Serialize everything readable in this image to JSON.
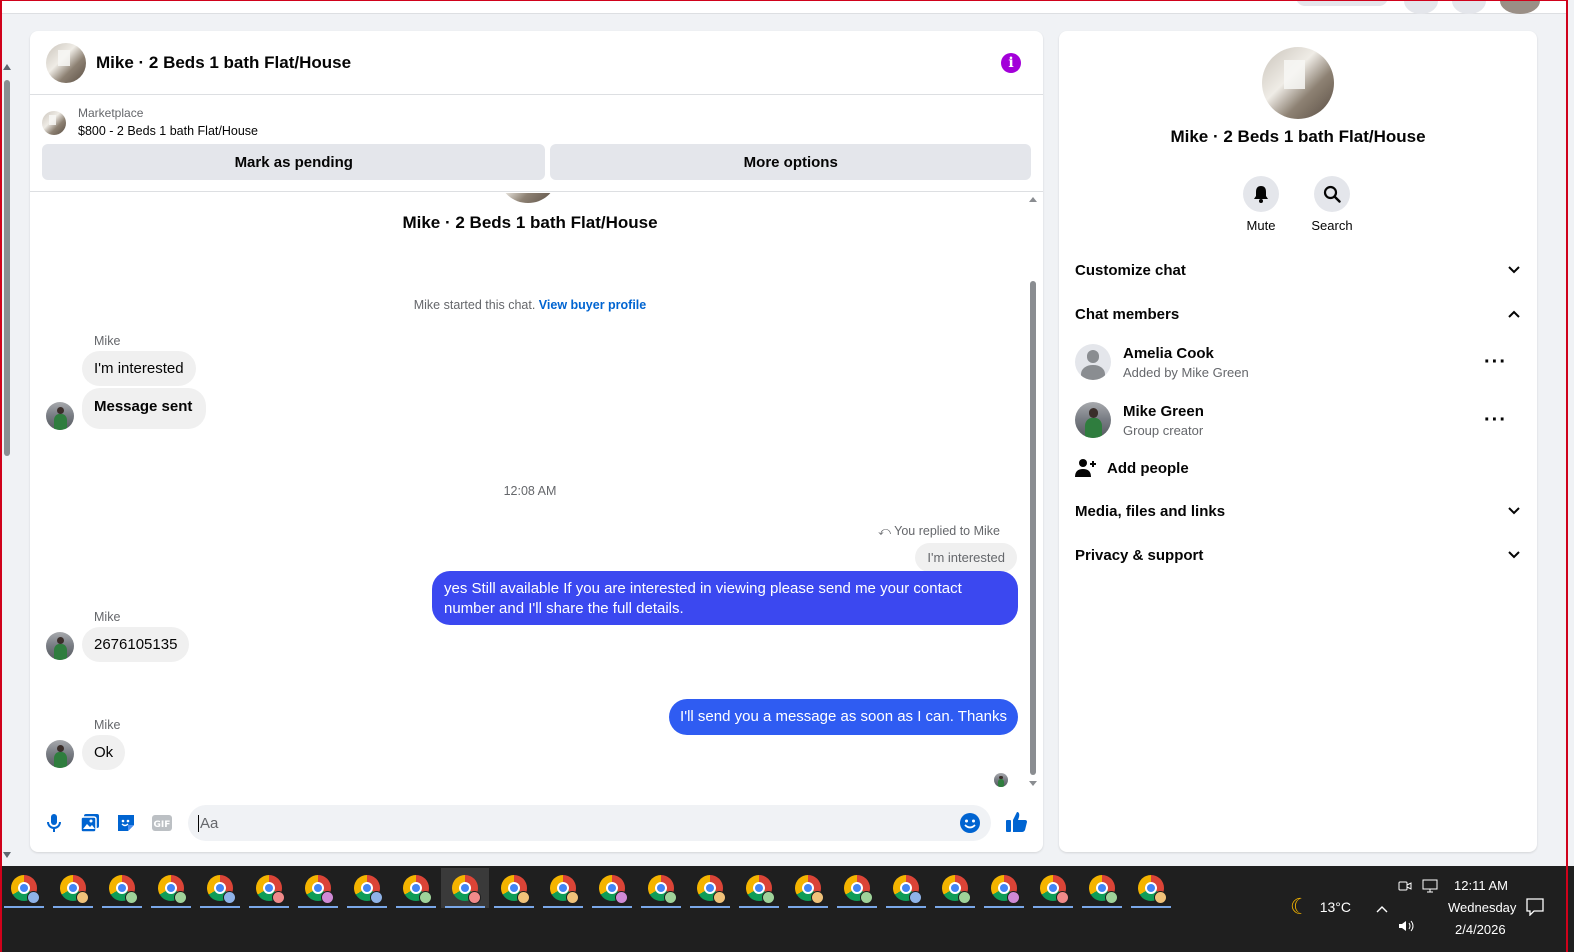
{
  "chat": {
    "title": "Mike · 2 Beds 1 bath Flat/House",
    "listing": {
      "label": "Marketplace",
      "price_title": "$800 - 2 Beds 1 bath Flat/House",
      "mark_pending": "Mark as pending",
      "more_options": "More options"
    },
    "thread": {
      "center_name": "Mike · 2 Beds 1 bath Flat/House",
      "started_text": "Mike started this chat.",
      "buyer_profile_link": "View buyer profile",
      "groups": [
        {
          "sender": "Mike",
          "messages": [
            "I'm interested",
            "Message sent"
          ]
        },
        {
          "sender": "Mike",
          "messages": [
            "2676105135"
          ]
        },
        {
          "sender": "Mike",
          "messages": [
            "Ok"
          ]
        }
      ],
      "timestamp": "12:08 AM",
      "reply_note": "You replied to Mike",
      "quoted": "I'm interested",
      "outgoing": [
        "yes Still available If you are interested in viewing please send me your contact number and I'll share the full details.",
        "I'll send you a message as soon as I can. Thanks"
      ]
    },
    "composer": {
      "placeholder": "Aa",
      "value": ""
    }
  },
  "details": {
    "title": "Mike · 2 Beds 1 bath Flat/House",
    "actions": {
      "mute": "Mute",
      "search": "Search"
    },
    "sections": {
      "customize": "Customize chat",
      "members": "Chat members",
      "media": "Media, files and links",
      "privacy": "Privacy & support"
    },
    "members": [
      {
        "name": "Amelia Cook",
        "sub": "Added by Mike Green"
      },
      {
        "name": "Mike Green",
        "sub": "Group creator"
      }
    ],
    "add_people": "Add people"
  },
  "taskbar": {
    "weather": "13°C",
    "time": "12:11 AM",
    "day": "Wednesday",
    "date": "2/4/2026",
    "app_count": 24,
    "active_index": 9,
    "badge_colors": [
      "#8fb3e8",
      "#f0c27a",
      "#9fd39a",
      "#9fd39a",
      "#8fb3e8",
      "#f08a8a",
      "#d08ad6",
      "#8fb3e8",
      "#9fd39a",
      "#f08a8a",
      "#f0c27a",
      "#f0c27a",
      "#d08ad6",
      "#9fd39a",
      "#f0c27a",
      "#9fd39a",
      "#f0c27a",
      "#9fd39a",
      "#8fb3e8",
      "#9fd39a",
      "#d08ad6",
      "#f08a8a",
      "#9fd39a",
      "#f0c27a"
    ]
  },
  "colors": {
    "messenger_blue": "#0064d1",
    "outgoing_bubble": "#3b48f0",
    "info_purple": "#a300d9"
  }
}
